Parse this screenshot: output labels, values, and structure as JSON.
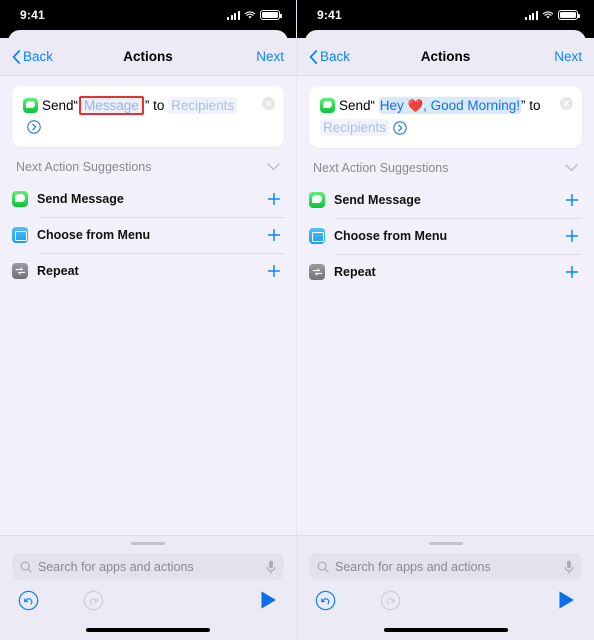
{
  "status_bar": {
    "time": "9:41",
    "icons": [
      "cellular-bars-icon",
      "wifi-icon",
      "battery-icon"
    ]
  },
  "nav": {
    "back_label": "Back",
    "title": "Actions",
    "next_label": "Next",
    "back_icon": "chevron-left-icon"
  },
  "colors": {
    "accent_blue": "#0a84ff",
    "token_blue": "#1273e6",
    "token_placeholder": "#8aa6d8",
    "highlight_red": "#e8302a",
    "background": "#f2f0fa",
    "chrome": "#ecebf5",
    "card": "#ffffff"
  },
  "panels": [
    {
      "id": "left-panel",
      "action_card": {
        "app_icon": "messages-app-icon",
        "verb": "Send",
        "open_quote": "“",
        "message_token": "Message",
        "message_token_state": "placeholder-selected",
        "close_quote": "”",
        "preposition": "to",
        "recipients_token": "Recipients",
        "disclosure_icon": "chevron-right-circle-icon",
        "clear_icon": "clear-circle-icon"
      }
    },
    {
      "id": "right-panel",
      "action_card": {
        "app_icon": "messages-app-icon",
        "verb": "Send",
        "open_quote": "“",
        "message_token": "Hey ❤️, Good Morning!",
        "message_token_part1": "Hey",
        "message_token_emoji": "❤️",
        "message_token_part2": ", Good Morning!",
        "message_token_state": "filled",
        "close_quote": "”",
        "preposition": "to",
        "recipients_token": "Recipients",
        "disclosure_icon": "chevron-right-circle-icon",
        "clear_icon": "clear-circle-icon"
      }
    }
  ],
  "suggestions": {
    "header_label": "Next Action Suggestions",
    "collapse_icon": "chevron-down-icon",
    "items": [
      {
        "label": "Send Message",
        "icon": "messages-app-icon",
        "add_icon": "plus-icon"
      },
      {
        "label": "Choose from Menu",
        "icon": "menu-app-icon",
        "add_icon": "plus-icon"
      },
      {
        "label": "Repeat",
        "icon": "repeat-app-icon",
        "add_icon": "plus-icon"
      }
    ]
  },
  "dock": {
    "grabber": "sheet-grabber",
    "search": {
      "placeholder": "Search for apps and actions",
      "search_icon": "search-icon",
      "mic_icon": "microphone-icon"
    },
    "toolbar": {
      "undo_icon": "undo-icon",
      "redo_icon": "redo-icon",
      "redo_disabled": true,
      "play_icon": "play-icon"
    },
    "home_indicator": "home-indicator"
  }
}
